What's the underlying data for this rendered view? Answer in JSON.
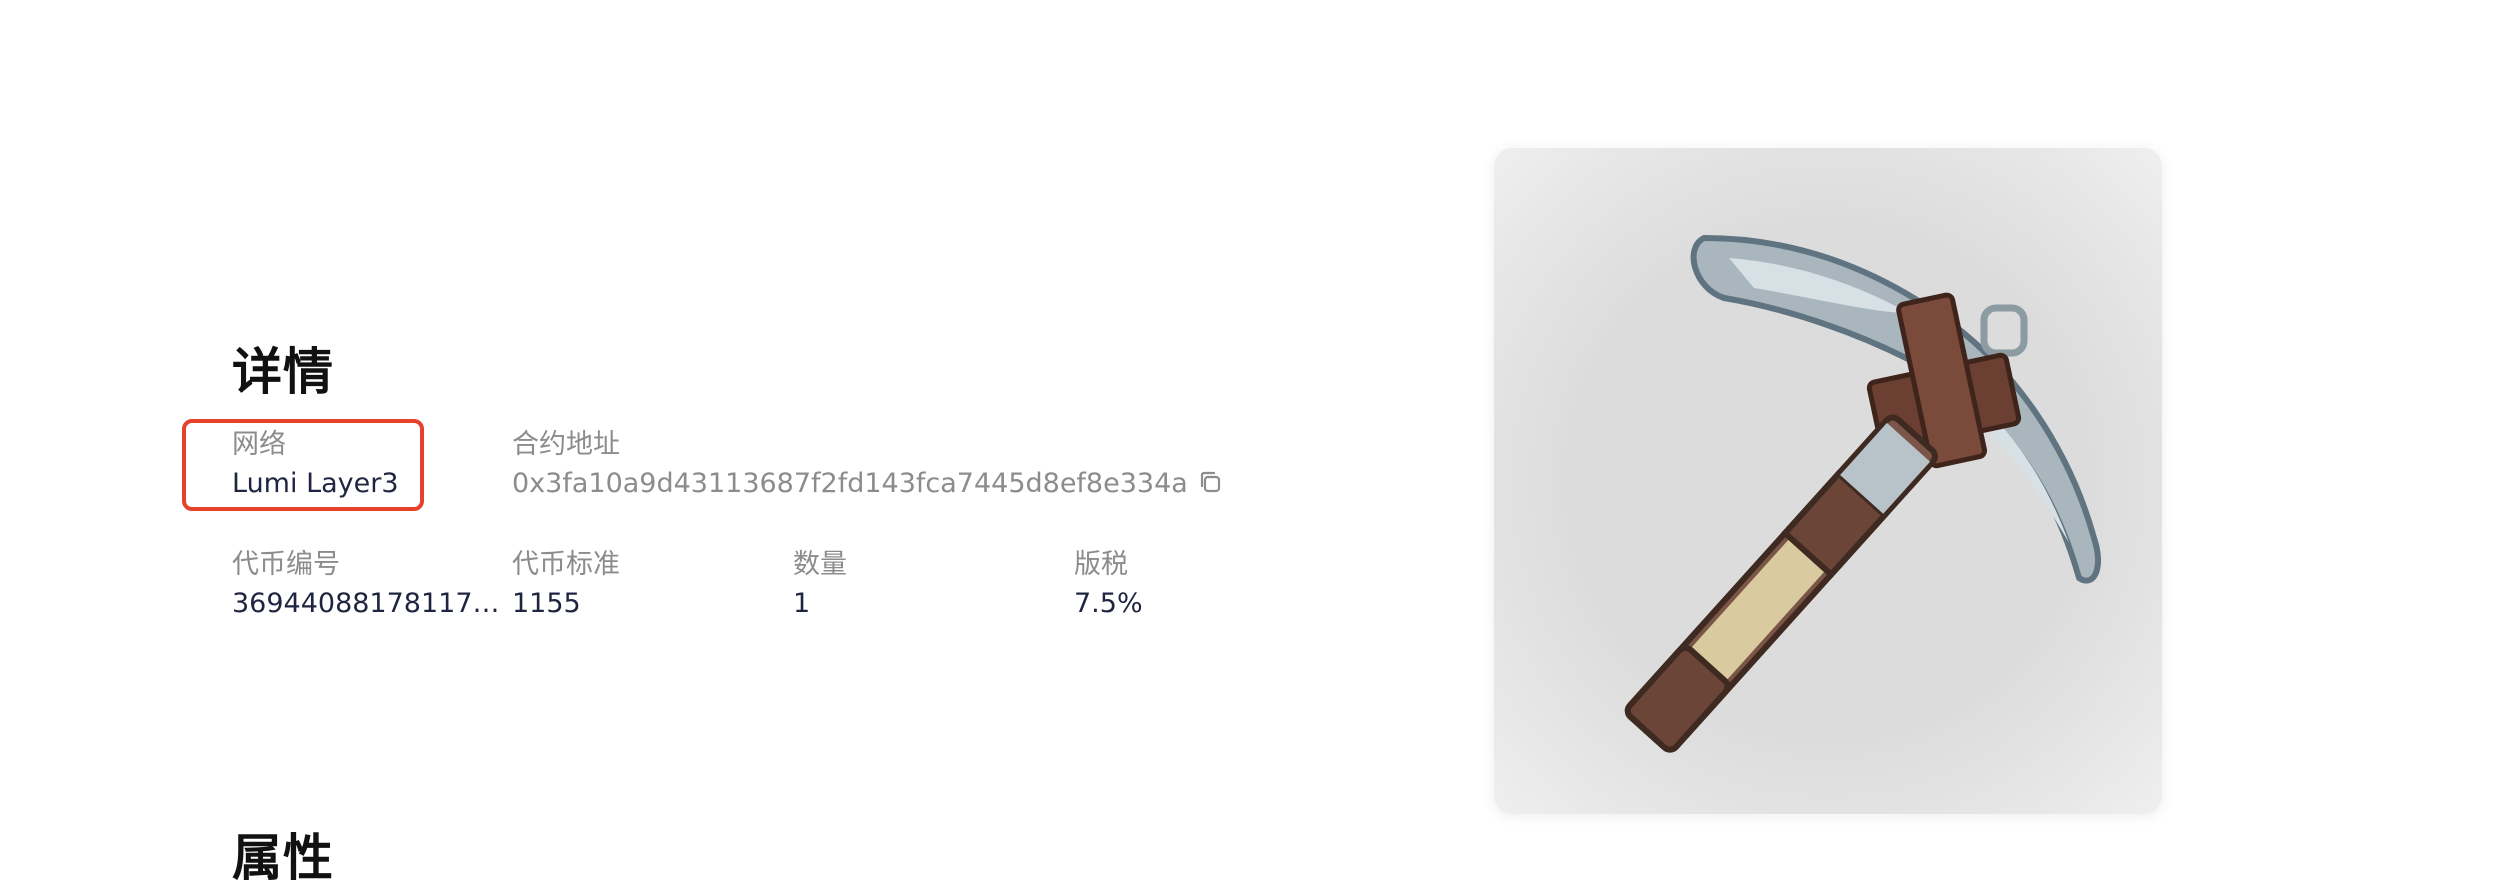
{
  "details": {
    "title": "详情",
    "network": {
      "label": "网络",
      "value": "Lumi Layer3"
    },
    "contract": {
      "label": "合约地址",
      "value": "0x3fa10a9d43113687f2fd143fca7445d8ef8e334a"
    },
    "token_id": {
      "label": "代币编号",
      "value": "369440881781170..."
    },
    "standard": {
      "label": "代币标准",
      "value": "1155"
    },
    "quantity": {
      "label": "数量",
      "value": "1"
    },
    "royalty": {
      "label": "版税",
      "value": "7.5%"
    }
  },
  "attributes": {
    "title": "属性"
  },
  "icons": {
    "copy": "copy-icon"
  },
  "colors": {
    "highlight": "#e5422b",
    "label": "#8c8c8c",
    "value": "#1f2540"
  }
}
